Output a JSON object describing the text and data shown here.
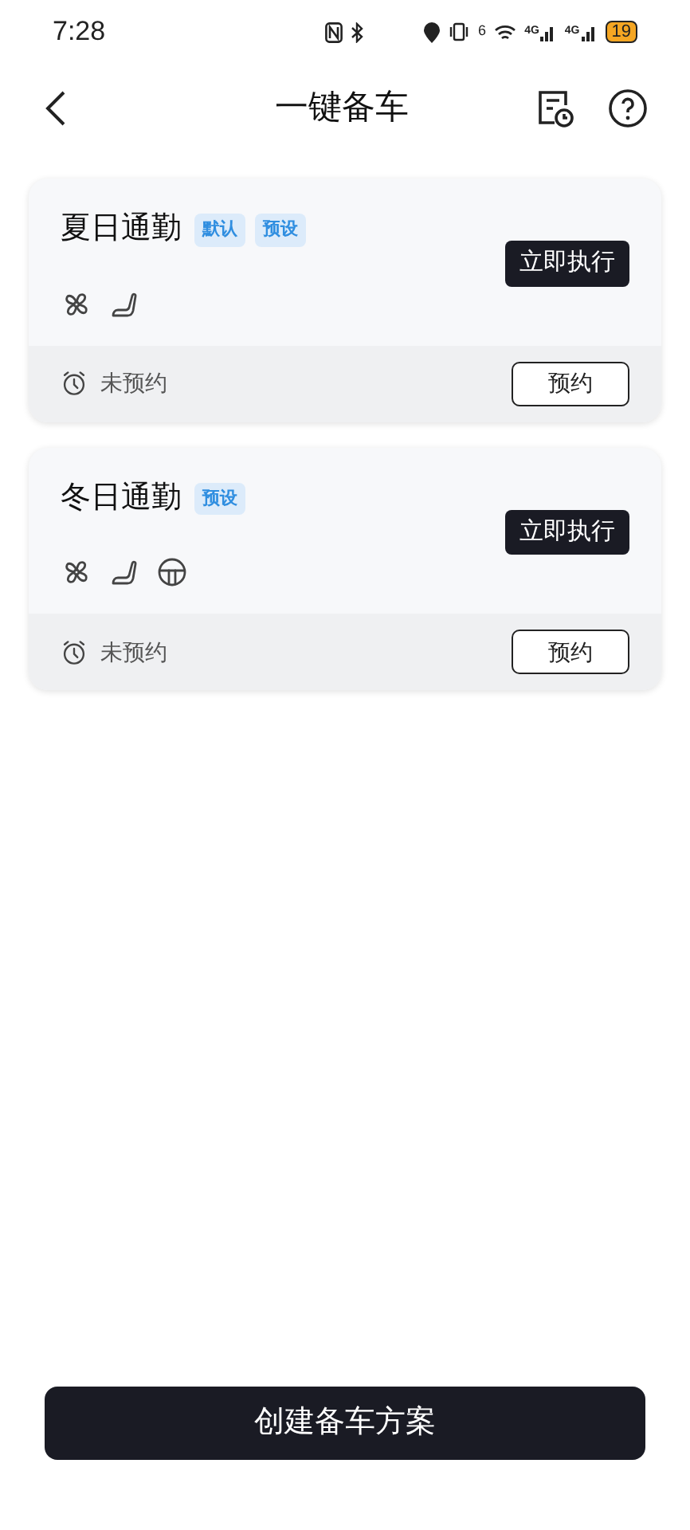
{
  "status_bar": {
    "time": "7:28",
    "wifi_badge": "6",
    "signal_labels": [
      "4G",
      "4G"
    ],
    "battery": "19"
  },
  "header": {
    "title": "一键备车"
  },
  "plans": [
    {
      "name": "夏日通勤",
      "tags": [
        "默认",
        "预设"
      ],
      "features": [
        {
          "kind": "fan"
        },
        {
          "kind": "seat"
        }
      ],
      "run_button": "立即执行",
      "schedule_status": "未预约",
      "schedule_button": "预约"
    },
    {
      "name": "冬日通勤",
      "tags": [
        "预设"
      ],
      "features": [
        {
          "kind": "fan"
        },
        {
          "kind": "seat"
        },
        {
          "kind": "wheel"
        }
      ],
      "run_button": "立即执行",
      "schedule_status": "未预约",
      "schedule_button": "预约"
    }
  ],
  "create_button": "创建备车方案"
}
